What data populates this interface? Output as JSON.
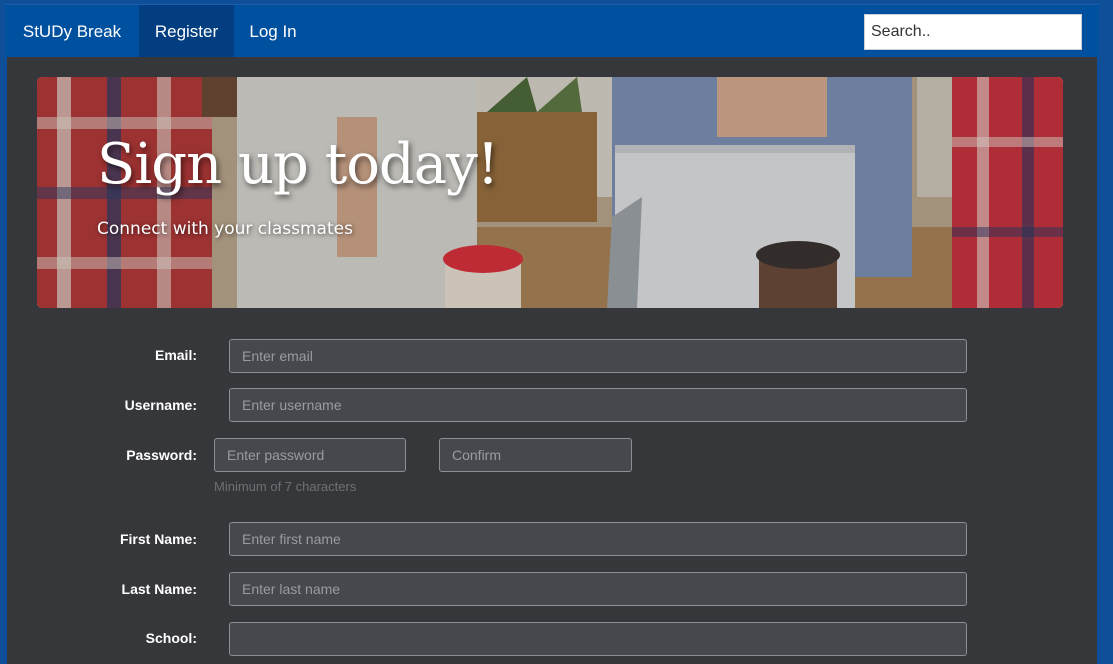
{
  "nav": {
    "brand": "StUDy Break",
    "register": "Register",
    "login": "Log In",
    "search_placeholder": "Search.."
  },
  "hero": {
    "title": "Sign up today!",
    "subtitle": "Connect with your classmates"
  },
  "form": {
    "email": {
      "label": "Email:",
      "placeholder": "Enter email"
    },
    "username": {
      "label": "Username:",
      "placeholder": "Enter username"
    },
    "password": {
      "label": "Password:",
      "placeholder": "Enter password",
      "confirm_placeholder": "Confirm",
      "help": "Minimum of 7 characters"
    },
    "first_name": {
      "label": "First Name:",
      "placeholder": "Enter first name"
    },
    "last_name": {
      "label": "Last Name:",
      "placeholder": "Enter last name"
    },
    "school": {
      "label": "School:",
      "placeholder": ""
    }
  },
  "colors": {
    "navbar": "#0050a0",
    "navbar_active": "#033f80",
    "panel": "#36373b",
    "input_bg": "#47484d"
  }
}
